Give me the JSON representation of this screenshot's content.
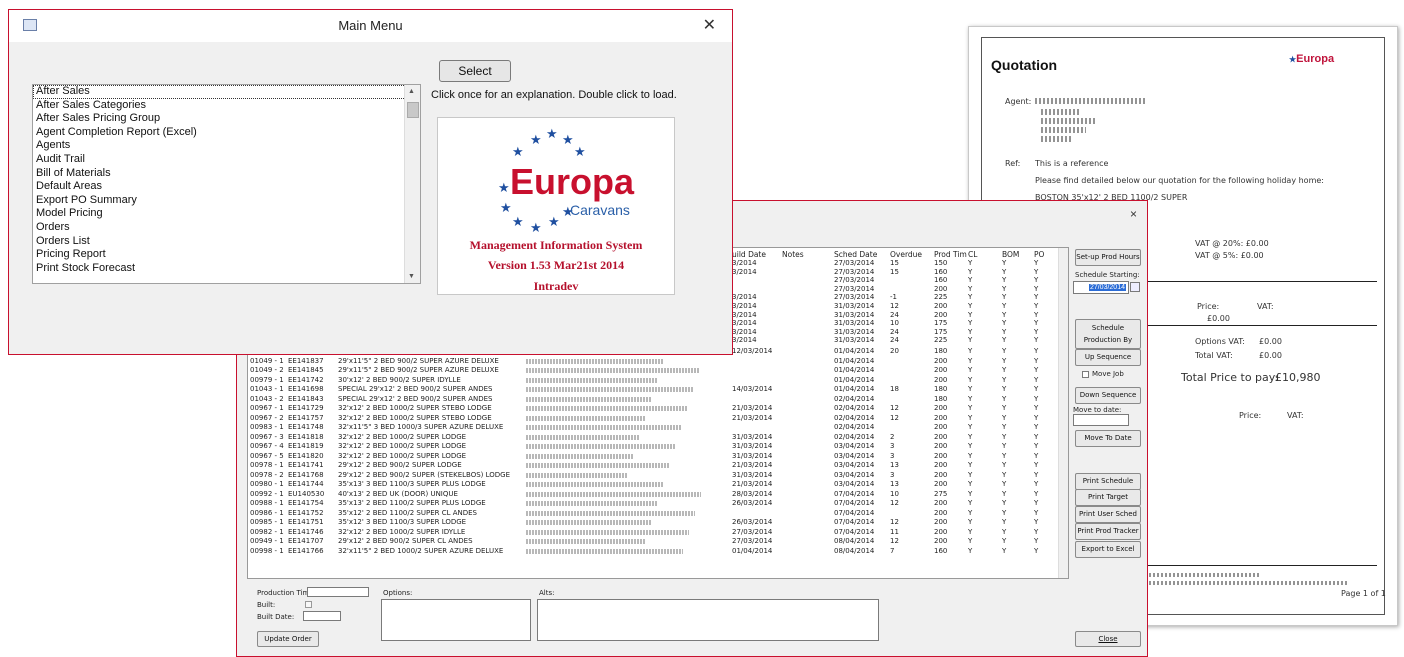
{
  "main_menu": {
    "title": "Main Menu",
    "close_glyph": "✕",
    "list_items": [
      "After Sales",
      "After Sales Categories",
      "After Sales Pricing Group",
      "Agent Completion Report (Excel)",
      "Agents",
      "Audit Trail",
      "Bill of Materials",
      "Default Areas",
      "Export PO Summary",
      "Model Pricing",
      "Orders",
      "Orders List",
      "Pricing Report",
      "Print Stock Forecast"
    ],
    "select_label": "Select",
    "hint": "Click once for an explanation. Double click to load.",
    "logo_word": "Europa",
    "logo_sub": "Caravans",
    "system_name": "Management Information System",
    "version": "Version 1.53  Mar21st 2014",
    "vendor": "Intradev"
  },
  "schedule": {
    "close_glyph": "×",
    "columns": [
      "uild Date",
      "Notes",
      "Sched Date",
      "Overdue",
      "Prod Tim",
      "CL",
      "BOM",
      "PO"
    ],
    "top_rows": [
      {
        "build": "3/2014",
        "sched": "27/03/2014",
        "over": "15",
        "prod": "150",
        "cl": "Y",
        "bom": "Y",
        "po": "Y"
      },
      {
        "build": "3/2014",
        "sched": "27/03/2014",
        "over": "15",
        "prod": "160",
        "cl": "Y",
        "bom": "Y",
        "po": "Y"
      },
      {
        "build": "",
        "sched": "27/03/2014",
        "over": "",
        "prod": "160",
        "cl": "Y",
        "bom": "Y",
        "po": "Y"
      },
      {
        "build": "",
        "sched": "27/03/2014",
        "over": "",
        "prod": "200",
        "cl": "Y",
        "bom": "Y",
        "po": "Y"
      },
      {
        "build": "3/2014",
        "sched": "27/03/2014",
        "over": "-1",
        "prod": "225",
        "cl": "Y",
        "bom": "Y",
        "po": "Y"
      },
      {
        "build": "3/2014",
        "sched": "31/03/2014",
        "over": "12",
        "prod": "200",
        "cl": "Y",
        "bom": "Y",
        "po": "Y"
      },
      {
        "build": "3/2014",
        "sched": "31/03/2014",
        "over": "24",
        "prod": "200",
        "cl": "Y",
        "bom": "Y",
        "po": "Y"
      },
      {
        "build": "3/2014",
        "sched": "31/03/2014",
        "over": "10",
        "prod": "175",
        "cl": "Y",
        "bom": "Y",
        "po": "Y"
      },
      {
        "build": "3/2014",
        "sched": "31/03/2014",
        "over": "24",
        "prod": "175",
        "cl": "Y",
        "bom": "Y",
        "po": "Y"
      },
      {
        "build": "3/2014",
        "sched": "31/03/2014",
        "over": "24",
        "prod": "225",
        "cl": "Y",
        "bom": "Y",
        "po": "Y"
      }
    ],
    "rows": [
      {
        "ord": "00976 - 1",
        "ser": "EE141739",
        "model": "26'x11'5\" 2 BED 850/2 SUPER AZURE DELUXE",
        "build": "12/03/2014",
        "sched": "01/04/2014",
        "over": "20",
        "prod": "180"
      },
      {
        "ord": "01049 - 1",
        "ser": "EE141837",
        "model": "29'x11'5\" 2 BED 900/2 SUPER AZURE DELUXE",
        "build": "",
        "sched": "01/04/2014",
        "over": "",
        "prod": "200"
      },
      {
        "ord": "01049 - 2",
        "ser": "EE141845",
        "model": "29'x11'5\" 2 BED 900/2 SUPER AZURE DELUXE",
        "build": "",
        "sched": "01/04/2014",
        "over": "",
        "prod": "200"
      },
      {
        "ord": "00979 - 1",
        "ser": "EE141742",
        "model": "30'x12' 2 BED 900/2 SUPER IDYLLE",
        "build": "",
        "sched": "01/04/2014",
        "over": "",
        "prod": "200"
      },
      {
        "ord": "01043 - 1",
        "ser": "EE141698",
        "model": "SPECIAL 29'x12' 2 BED 900/2 SUPER ANDES",
        "build": "14/03/2014",
        "sched": "01/04/2014",
        "over": "18",
        "prod": "180"
      },
      {
        "ord": "01043 - 2",
        "ser": "EE141843",
        "model": "SPECIAL 29'x12' 2 BED 900/2 SUPER ANDES",
        "build": "",
        "sched": "02/04/2014",
        "over": "",
        "prod": "180"
      },
      {
        "ord": "00967 - 1",
        "ser": "EE141729",
        "model": "32'x12' 2 BED 1000/2 SUPER STEBO LODGE",
        "build": "21/03/2014",
        "sched": "02/04/2014",
        "over": "12",
        "prod": "200"
      },
      {
        "ord": "00967 - 2",
        "ser": "EE141757",
        "model": "32'x12' 2 BED 1000/2 SUPER STEBO LODGE",
        "build": "21/03/2014",
        "sched": "02/04/2014",
        "over": "12",
        "prod": "200"
      },
      {
        "ord": "00983 - 1",
        "ser": "EE141748",
        "model": "32'x11'5\" 3 BED 1000/3 SUPER AZURE DELUXE",
        "build": "",
        "sched": "02/04/2014",
        "over": "",
        "prod": "200"
      },
      {
        "ord": "00967 - 3",
        "ser": "EE141818",
        "model": "32'x12' 2 BED 1000/2 SUPER LODGE",
        "build": "31/03/2014",
        "sched": "02/04/2014",
        "over": "2",
        "prod": "200"
      },
      {
        "ord": "00967 - 4",
        "ser": "EE141819",
        "model": "32'x12' 2 BED 1000/2 SUPER LODGE",
        "build": "31/03/2014",
        "sched": "03/04/2014",
        "over": "3",
        "prod": "200"
      },
      {
        "ord": "00967 - 5",
        "ser": "EE141820",
        "model": "32'x12' 2 BED 1000/2 SUPER LODGE",
        "build": "31/03/2014",
        "sched": "03/04/2014",
        "over": "3",
        "prod": "200"
      },
      {
        "ord": "00978 - 1",
        "ser": "EE141741",
        "model": "29'x12' 2 BED 900/2 SUPER LODGE",
        "build": "21/03/2014",
        "sched": "03/04/2014",
        "over": "13",
        "prod": "200"
      },
      {
        "ord": "00978 - 2",
        "ser": "EE141768",
        "model": "29'x12' 2 BED 900/2 SUPER (STEKELBOS) LODGE",
        "build": "31/03/2014",
        "sched": "03/04/2014",
        "over": "3",
        "prod": "200"
      },
      {
        "ord": "00980 - 1",
        "ser": "EE141744",
        "model": "35'x13' 3 BED 1100/3 SUPER PLUS LODGE",
        "build": "21/03/2014",
        "sched": "03/04/2014",
        "over": "13",
        "prod": "200"
      },
      {
        "ord": "00992 - 1",
        "ser": "EU140530",
        "model": "40'x13' 2 BED UK (DOOR) UNIQUE",
        "build": "28/03/2014",
        "sched": "07/04/2014",
        "over": "10",
        "prod": "275"
      },
      {
        "ord": "00988 - 1",
        "ser": "EE141754",
        "model": "35'x13' 2 BED 1100/2 SUPER PLUS LODGE",
        "build": "26/03/2014",
        "sched": "07/04/2014",
        "over": "12",
        "prod": "200"
      },
      {
        "ord": "00986 - 1",
        "ser": "EE141752",
        "model": "35'x12' 2 BED 1100/2 SUPER CL ANDES",
        "build": "",
        "sched": "07/04/2014",
        "over": "",
        "prod": "200"
      },
      {
        "ord": "00985 - 1",
        "ser": "EE141751",
        "model": "35'x12' 3 BED 1100/3 SUPER LODGE",
        "build": "26/03/2014",
        "sched": "07/04/2014",
        "over": "12",
        "prod": "200"
      },
      {
        "ord": "00982 - 1",
        "ser": "EE141746",
        "model": "32'x12' 2 BED 1000/2 SUPER IDYLLE",
        "build": "27/03/2014",
        "sched": "07/04/2014",
        "over": "11",
        "prod": "200"
      },
      {
        "ord": "00949 - 1",
        "ser": "EE141707",
        "model": "29'x12' 2 BED 900/2 SUPER CL ANDES",
        "build": "27/03/2014",
        "sched": "08/04/2014",
        "over": "12",
        "prod": "200"
      },
      {
        "ord": "00998 - 1",
        "ser": "EE141766",
        "model": "32'x11'5\" 2 BED 1000/2 SUPER AZURE DELUXE",
        "build": "01/04/2014",
        "sched": "08/04/2014",
        "over": "7",
        "prod": "160"
      }
    ],
    "buttons": {
      "setup_prod_hours": "Set-up Prod Hours",
      "schedule_starting_label": "Schedule Starting:",
      "schedule_starting_value": "27/03/2014",
      "schedule_by_target": "Schedule Production By Target",
      "up_sequence": "Up Sequence",
      "move_job": "Move Job",
      "down_sequence": "Down Sequence",
      "move_to_date_label": "Move to date:",
      "move_to_date": "Move To Date",
      "print_schedule": "Print Schedule",
      "print_target": "Print Target",
      "print_user_sched": "Print User Sched",
      "print_prod_tracker": "Print Prod Tracker",
      "export_excel": "Export to Excel",
      "close": "Close",
      "update_order": "Update Order"
    },
    "fields": {
      "production_time": "Production Time:",
      "built": "Built:",
      "built_date": "Built Date:",
      "options": "Options:",
      "alts": "Alts:"
    }
  },
  "quotation": {
    "title": "Quotation",
    "logo": "Europa",
    "agent_label": "Agent:",
    "ref_label": "Ref:",
    "ref_value": "This is a reference",
    "intro": "Please find detailed below our quotation for the following holiday home:",
    "model": "BOSTON 35'x12' 2 BED 1100/2 SUPER",
    "vat1": "VAT @ 20%:  £0.00",
    "vat2": "VAT @ 5%:  £0.00",
    "price_label": "Price:",
    "vat_label": "VAT:",
    "price_val": "£0.00",
    "options_vat": "Options VAT:",
    "options_vat_val": "£0.00",
    "total_vat": "Total VAT:",
    "total_vat_val": "£0.00",
    "total_price": "Total Price to pay:",
    "total_price_val": "£10,980",
    "price_label2": "Price:",
    "vat_label2": "VAT:",
    "footer": "Page 1 of 1"
  },
  "colors": {
    "brand_red": "#c8102e",
    "brand_blue": "#1f4fa0"
  }
}
